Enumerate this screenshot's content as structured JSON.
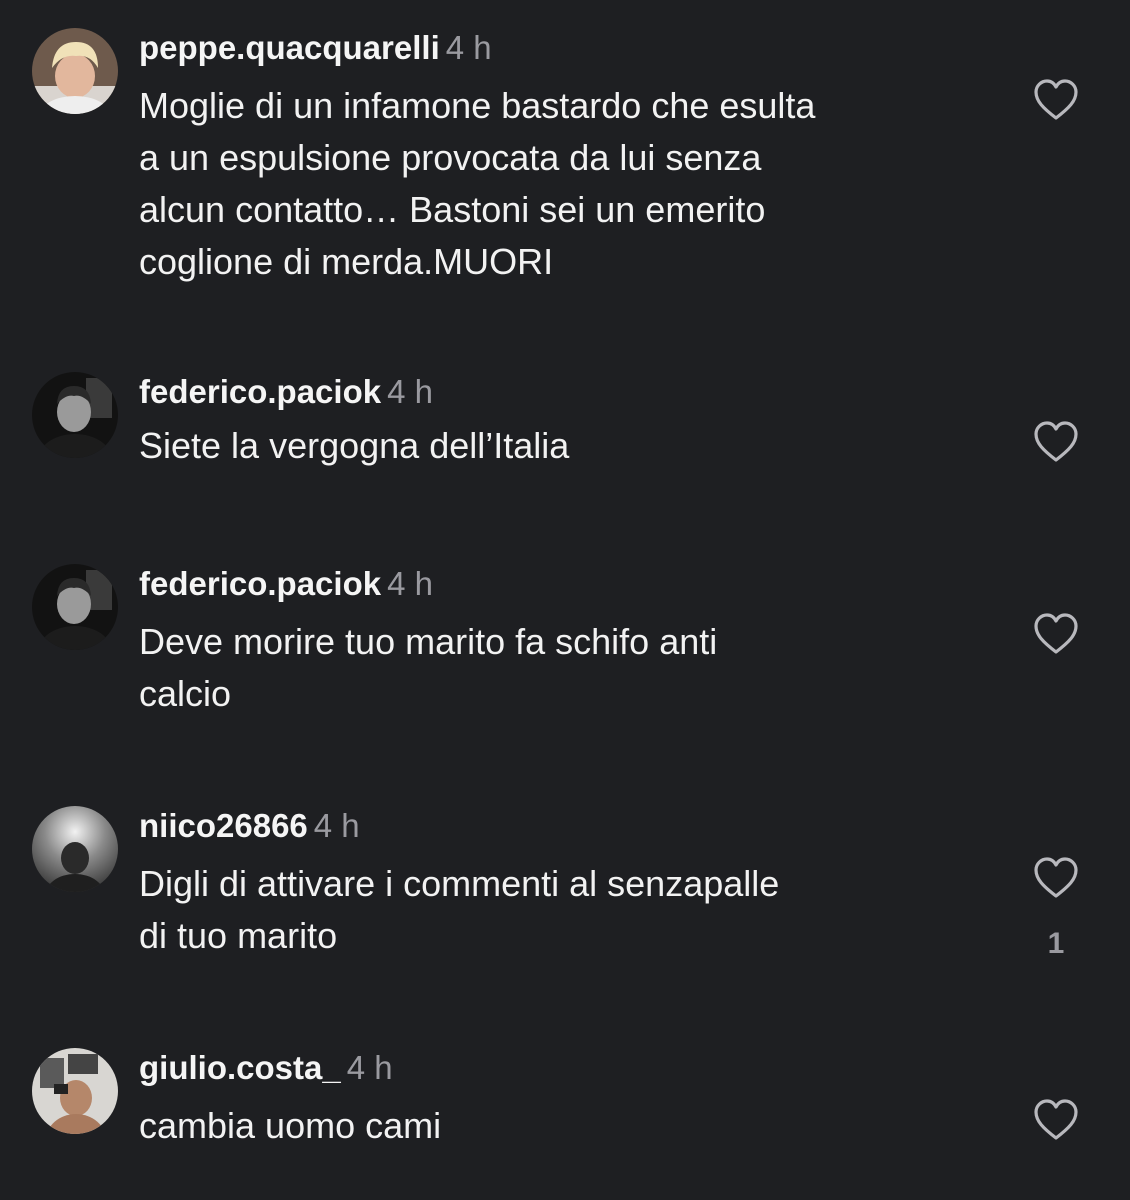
{
  "comments": [
    {
      "username": "peppe.quacquarelli",
      "time": "4 h",
      "text": "Moglie di un infamone bastardo che esulta\na un espulsione provocata da lui senza\nalcun contatto… Bastoni sei un emerito\ncoglione di merda.MUORI",
      "avatar": "avatar-photo-blond-person",
      "like_icon": "heart-outline-icon"
    },
    {
      "username": "federico.paciok",
      "time": "4 h",
      "text": "Siete la vergogna dell’Italia",
      "avatar": "avatar-photo-dark-person",
      "like_icon": "heart-outline-icon"
    },
    {
      "username": "federico.paciok",
      "time": "4 h",
      "text": "Deve morire tuo marito fa schifo anti\ncalcio",
      "avatar": "avatar-photo-dark-person",
      "like_icon": "heart-outline-icon"
    },
    {
      "username": "niico26866",
      "time": "4 h",
      "text": "Digli di attivare i commenti al senzapalle\ndi tuo marito",
      "avatar": "avatar-photo-grey-silhouette",
      "like_icon": "heart-outline-icon",
      "like_count": "1"
    },
    {
      "username": "giulio.costa_",
      "time": "4 h",
      "text": "cambia uomo cami",
      "avatar": "avatar-photo-mirror-selfie",
      "like_icon": "heart-outline-icon"
    }
  ],
  "colors": {
    "background": "#1e1f22",
    "text": "#f2f2f2",
    "muted": "#9a9aa0"
  }
}
